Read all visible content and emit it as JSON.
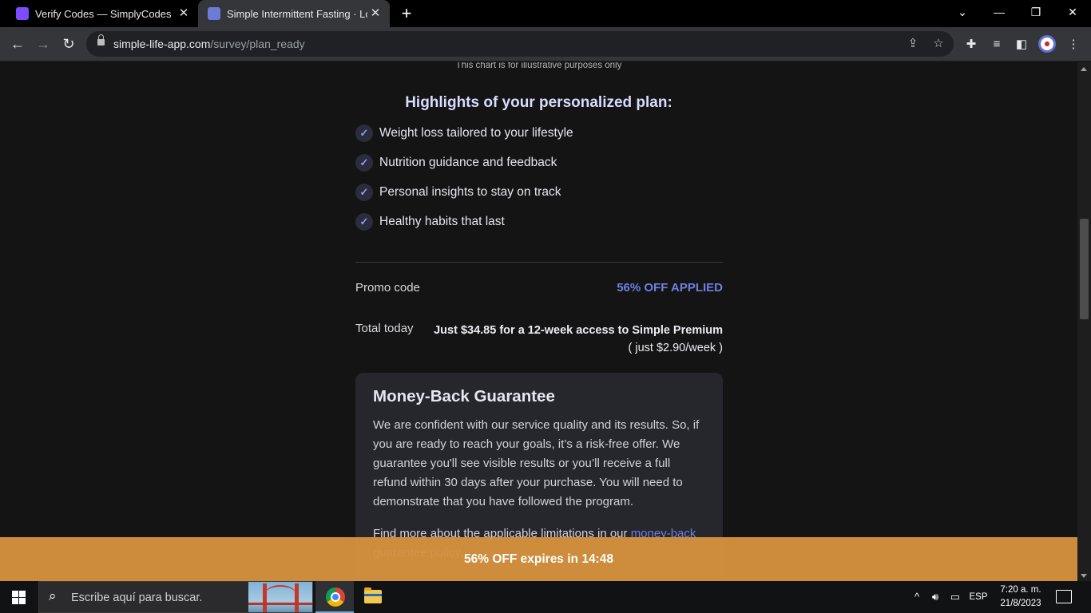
{
  "browser": {
    "tabs": [
      {
        "title": "Verify Codes — SimplyCodes",
        "active": false
      },
      {
        "title": "Simple Intermittent Fasting · Lose",
        "active": true
      }
    ],
    "new_tab_icon": "plus-icon",
    "window_controls": {
      "minimize": "—",
      "restore": "❐",
      "close": "✕",
      "tab_search": "⌄"
    },
    "url_host": "simple-life-app.com",
    "url_path": "/survey/plan_ready"
  },
  "page": {
    "chart_caption": "This chart is for illustrative purposes only",
    "highlights_title": "Highlights of your personalized plan:",
    "highlights": [
      "Weight loss tailored to your lifestyle",
      "Nutrition guidance and feedback",
      "Personal insights to stay on track",
      "Healthy habits that last"
    ],
    "promo_label": "Promo code",
    "promo_value": "56% OFF APPLIED",
    "total_label": "Total today",
    "total_main": "Just $34.85 for a 12-week access to Simple Premium",
    "total_sub": "( just $2.90/week )",
    "guarantee": {
      "title": "Money-Back Guarantee",
      "body": "We are confident with our service quality and its results. So, if you are ready to reach your goals, it’s a risk-free offer. We guarantee you'll see visible results or you’ll receive a full refund within 30 days after your purchase. You will need to demonstrate that you have followed the program.",
      "more_prefix": "Find more about the applicable limitations in our ",
      "more_link": "money-back guarantee policy",
      "more_suffix": "."
    },
    "banner": "56% OFF expires in 14:48",
    "accent_color": "#6f7fe0",
    "banner_color": "#db963e"
  },
  "taskbar": {
    "search_placeholder": "Escribe aquí para buscar.",
    "language": "ESP",
    "time": "7:20 a. m.",
    "date": "21/8/2023"
  }
}
